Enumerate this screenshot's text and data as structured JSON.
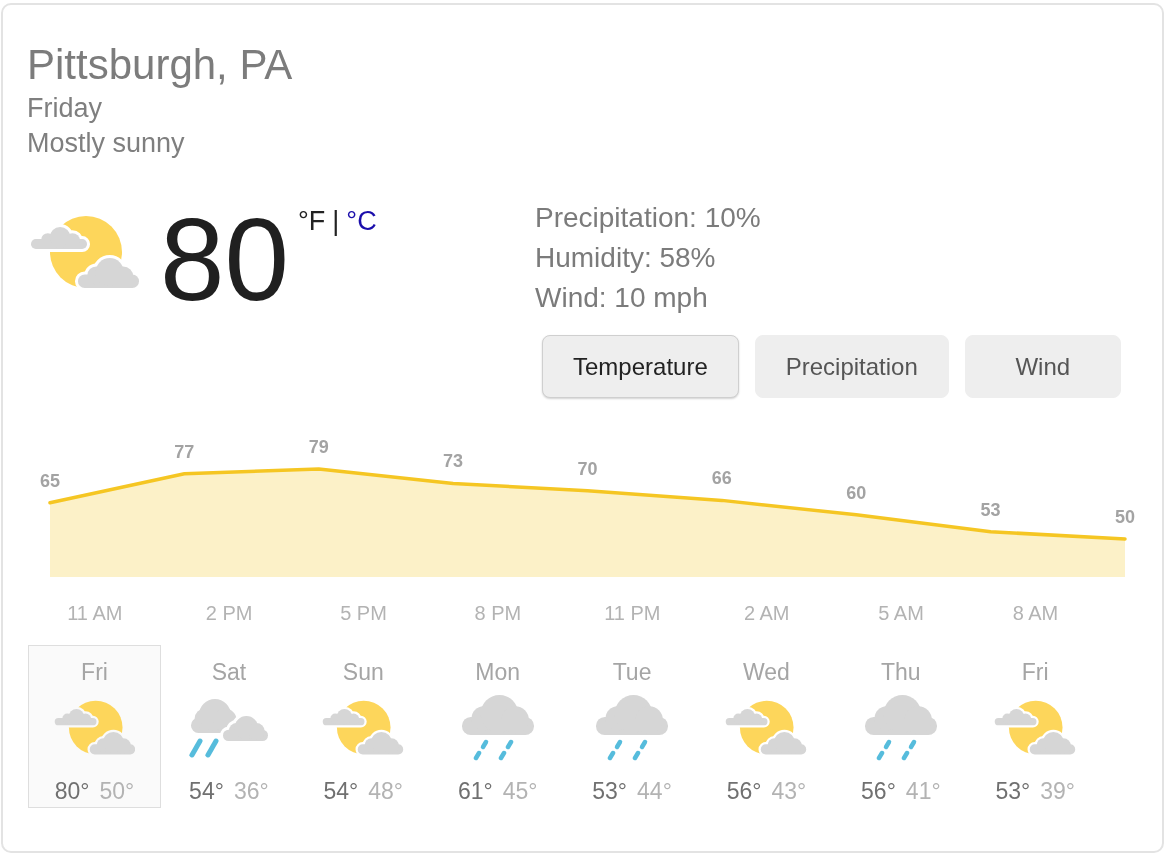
{
  "location": {
    "title": "Pittsburgh, PA",
    "day": "Friday",
    "condition": "Mostly sunny"
  },
  "current": {
    "kind": "sun-cloud",
    "temperature": "80",
    "units": [
      {
        "label": "°F",
        "selected": true
      },
      {
        "label": "°C",
        "selected": false
      }
    ],
    "unit_separator": "|"
  },
  "details": [
    "Precipitation: 10%",
    "Humidity: 58%",
    "Wind: 10 mph"
  ],
  "tabs": [
    {
      "label": "Temperature",
      "selected": true
    },
    {
      "label": "Precipitation",
      "selected": false
    },
    {
      "label": "Wind",
      "selected": false
    }
  ],
  "chart": {
    "chart_data": {
      "type": "area",
      "categories": [
        null,
        "11 AM",
        null,
        null,
        "2 PM",
        null,
        null,
        "5 PM",
        null,
        null,
        "8 PM",
        null,
        null,
        "11 PM",
        null,
        null,
        "2 AM",
        null,
        null,
        "5 AM",
        null,
        null,
        "8 AM",
        null,
        null
      ],
      "series": [
        {
          "color": "#f5c623",
          "values": [
            65,
            null,
            null,
            77,
            null,
            null,
            79,
            null,
            null,
            73,
            null,
            null,
            70,
            null,
            null,
            66,
            null,
            null,
            60,
            null,
            null,
            53,
            null,
            null,
            50
          ]
        }
      ],
      "data_labels": true
    }
  },
  "days": [
    {
      "day": "Fri",
      "kind": "sun-cloud",
      "high": "80°",
      "low": "50°",
      "selected": true
    },
    {
      "day": "Sat",
      "kind": "shower",
      "high": "54°",
      "low": "36°",
      "selected": false
    },
    {
      "day": "Sun",
      "kind": "sun-cloud",
      "high": "54°",
      "low": "48°",
      "selected": false
    },
    {
      "day": "Mon",
      "kind": "rain",
      "high": "61°",
      "low": "45°",
      "selected": false
    },
    {
      "day": "Tue",
      "kind": "rain",
      "high": "53°",
      "low": "44°",
      "selected": false
    },
    {
      "day": "Wed",
      "kind": "sun-cloud",
      "high": "56°",
      "low": "43°",
      "selected": false
    },
    {
      "day": "Thu",
      "kind": "rain",
      "high": "56°",
      "low": "41°",
      "selected": false
    },
    {
      "day": "Fri",
      "kind": "sun-cloud",
      "high": "53°",
      "low": "39°",
      "selected": false
    }
  ]
}
